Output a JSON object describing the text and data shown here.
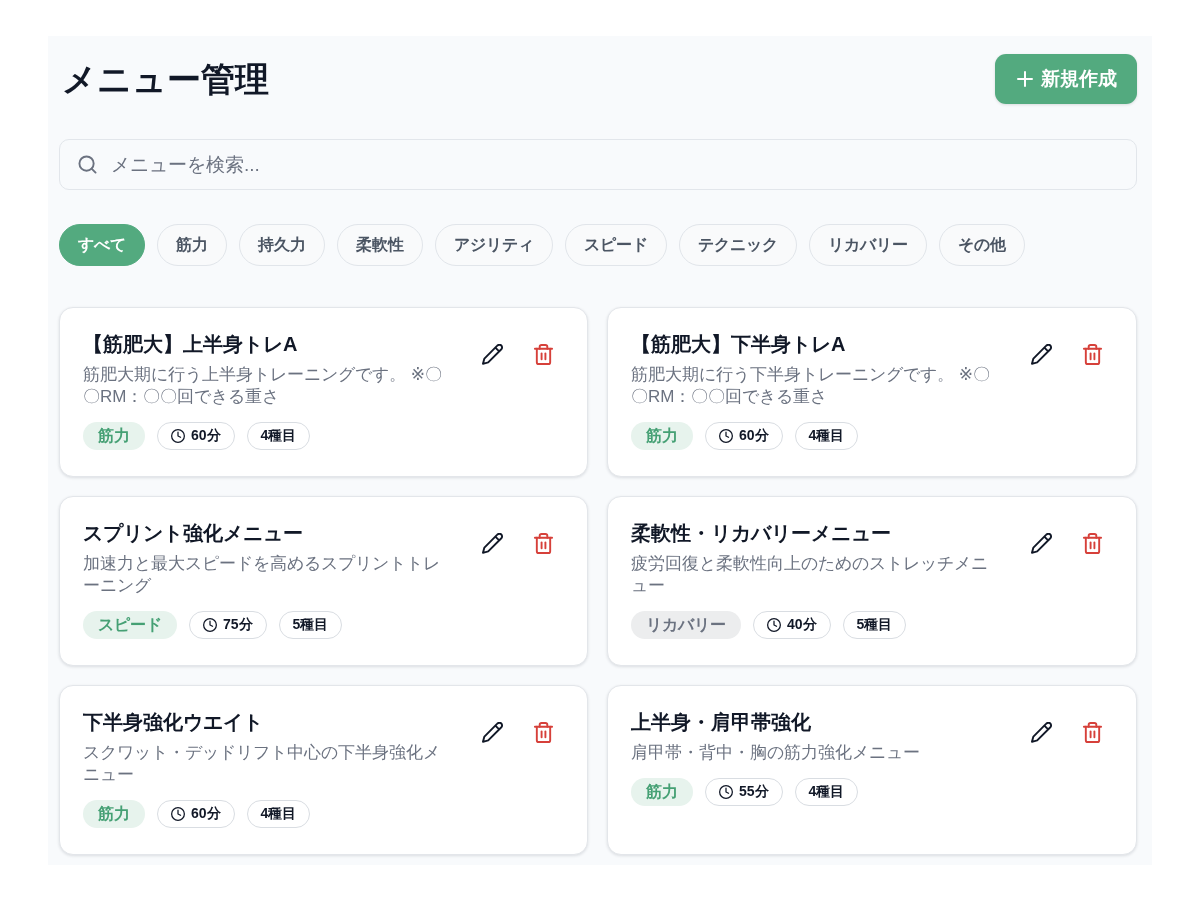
{
  "header": {
    "title": "メニュー管理",
    "new_button": {
      "label": "新規作成"
    }
  },
  "search": {
    "placeholder": "メニューを検索..."
  },
  "filters": [
    {
      "label": "すべて",
      "selected": true
    },
    {
      "label": "筋力",
      "selected": false
    },
    {
      "label": "持久力",
      "selected": false
    },
    {
      "label": "柔軟性",
      "selected": false
    },
    {
      "label": "アジリティ",
      "selected": false
    },
    {
      "label": "スピード",
      "selected": false
    },
    {
      "label": "テクニック",
      "selected": false
    },
    {
      "label": "リカバリー",
      "selected": false
    },
    {
      "label": "その他",
      "selected": false
    }
  ],
  "menus": [
    {
      "title": "【筋肥大】上半身トレA",
      "description": "筋肥大期に行う上半身トレーニングです。 ※〇〇RM：〇〇回できる重さ",
      "category": {
        "label": "筋力",
        "color": "#45a074"
      },
      "duration": "60分",
      "exercises": "4種目"
    },
    {
      "title": "【筋肥大】下半身トレA",
      "description": "筋肥大期に行う下半身トレーニングです。 ※〇〇RM：〇〇回できる重さ",
      "category": {
        "label": "筋力",
        "color": "#45a074"
      },
      "duration": "60分",
      "exercises": "4種目"
    },
    {
      "title": "スプリント強化メニュー",
      "description": "加速力と最大スピードを高めるスプリントトレーニング",
      "category": {
        "label": "スピード",
        "color": "#45a074"
      },
      "duration": "75分",
      "exercises": "5種目"
    },
    {
      "title": "柔軟性・リカバリーメニュー",
      "description": "疲労回復と柔軟性向上のためのストレッチメニュー",
      "category": {
        "label": "リカバリー",
        "color": "#6b7280"
      },
      "duration": "40分",
      "exercises": "5種目"
    },
    {
      "title": "下半身強化ウエイト",
      "description": "スクワット・デッドリフト中心の下半身強化メニュー",
      "category": {
        "label": "筋力",
        "color": "#45a074"
      },
      "duration": "60分",
      "exercises": "4種目"
    },
    {
      "title": "上半身・肩甲帯強化",
      "description": "肩甲帯・背中・胸の筋力強化メニュー",
      "category": {
        "label": "筋力",
        "color": "#45a074"
      },
      "duration": "55分",
      "exercises": "4種目"
    }
  ]
}
